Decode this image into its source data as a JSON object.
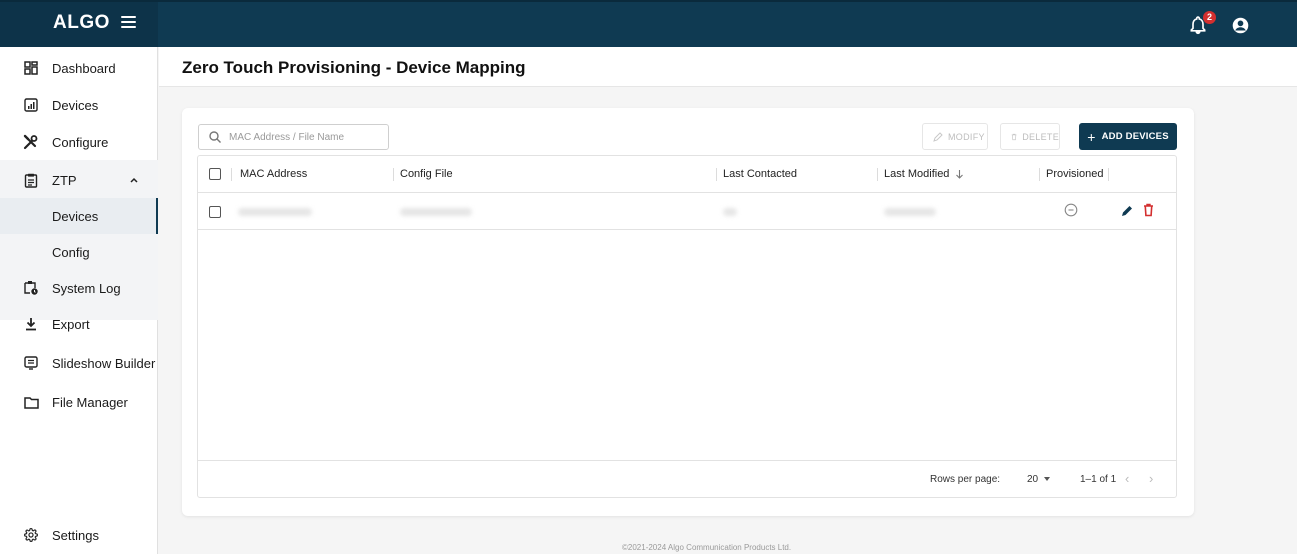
{
  "app": {
    "logo": "ALGO",
    "notification_count": "2"
  },
  "sidebar": {
    "items": [
      {
        "label": "Dashboard",
        "icon": "dashboard-icon"
      },
      {
        "label": "Devices",
        "icon": "devices-icon"
      },
      {
        "label": "Configure",
        "icon": "tools-icon"
      },
      {
        "label": "ZTP",
        "icon": "clipboard-icon",
        "expanded": true
      },
      {
        "label": "Devices",
        "selected": true
      },
      {
        "label": "Config"
      },
      {
        "label": "System Log",
        "icon": "system-log-icon"
      },
      {
        "label": "Export",
        "icon": "download-icon"
      },
      {
        "label": "Slideshow Builder",
        "icon": "slideshow-icon"
      },
      {
        "label": "File Manager",
        "icon": "folder-icon"
      },
      {
        "label": "Settings",
        "icon": "gear-icon"
      }
    ]
  },
  "page": {
    "title": "Zero Touch Provisioning - Device Mapping"
  },
  "toolbar": {
    "search_placeholder": "MAC Address / File Name",
    "modify_label": "MODIFY",
    "delete_label": "DELETE",
    "add_label": "ADD DEVICES"
  },
  "table": {
    "columns": [
      "MAC Address",
      "Config File",
      "Last Contacted",
      "Last Modified",
      "Provisioned"
    ],
    "sort_column": "Last Modified",
    "sort_direction": "descending",
    "rows": [
      {
        "mac_address": "",
        "config_file": "",
        "last_contacted": "",
        "last_modified": "",
        "provisioned": false
      }
    ]
  },
  "pagination": {
    "rows_per_page_label": "Rows per page:",
    "rows_per_page": "20",
    "range": "1–1 of 1"
  },
  "footer": {
    "copyright": "©2021-2024 Algo Communication Products Ltd."
  },
  "colors": {
    "primary": "#0f3a52",
    "delete": "#d32f2f",
    "badge": "#d32f2f"
  }
}
